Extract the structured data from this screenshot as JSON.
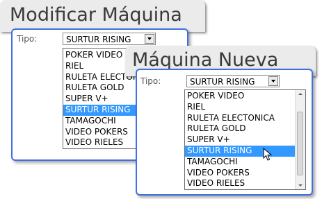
{
  "dialog_back": {
    "title": "Modificar Máquina",
    "tipo_label": "Tipo:",
    "selected_value": "SURTUR RISING",
    "options": [
      "POKER VIDEO",
      "RIEL",
      "RULETA ELECTONICA",
      "RULETA GOLD",
      "SUPER V+",
      "SURTUR RISING",
      "TAMAGOCHI",
      "VIDEO POKERS",
      "VIDEO RIELES"
    ],
    "highlighted_option": "SURTUR RISING"
  },
  "dialog_front": {
    "title": "Máquina Nueva",
    "tipo_label": "Tipo:",
    "selected_value": "SURTUR RISING",
    "options": [
      "POKER VIDEO",
      "RIEL",
      "RULETA ELECTONICA",
      "RULETA GOLD",
      "SUPER V+",
      "SURTUR RISING",
      "TAMAGOCHI",
      "VIDEO POKERS",
      "VIDEO RIELES"
    ],
    "highlighted_option": "SURTUR RISING"
  },
  "colors": {
    "panel_border": "#3f6fe0",
    "selection": "#3399ff",
    "title_tab_bg": "#ebebeb"
  },
  "icons": [
    "dropdown-arrow-icon",
    "scroll-up-icon",
    "scroll-down-icon",
    "mouse-pointer-icon"
  ]
}
